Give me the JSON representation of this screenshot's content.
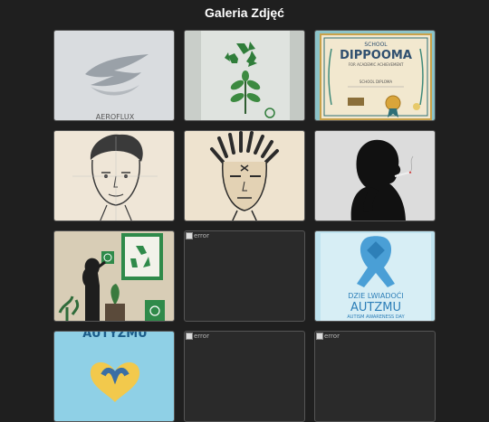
{
  "page": {
    "title": "Galeria Zdjęć"
  },
  "tiles": [
    {
      "kind": "image",
      "name": "aeroflux-logo",
      "caption": "AEROFLUX"
    },
    {
      "kind": "image",
      "name": "recycling-plant"
    },
    {
      "kind": "image",
      "name": "school-diploma",
      "line1": "SCHOOL",
      "line2": "DIPPOOMA",
      "line3": "FOR ACADEMIC ACHIEVEMENT",
      "line4": "SCHOOL DIPLOMA"
    },
    {
      "kind": "image",
      "name": "sketch-man-face"
    },
    {
      "kind": "image",
      "name": "dreadlocks-face"
    },
    {
      "kind": "image",
      "name": "smoker-silhouette"
    },
    {
      "kind": "image",
      "name": "smoker-recycling-room"
    },
    {
      "kind": "broken",
      "name": "broken-image",
      "alt": "error"
    },
    {
      "kind": "image",
      "name": "autism-awareness",
      "line1": "DZIE LWIADOĆI",
      "line2": "AUTZMU",
      "line3": "AUTISM AWARENESS DAY"
    },
    {
      "kind": "image",
      "name": "blue-heart-poster",
      "caption": "AUTYZMU"
    },
    {
      "kind": "broken",
      "name": "broken-image",
      "alt": "error"
    },
    {
      "kind": "broken",
      "name": "broken-image",
      "alt": "error"
    }
  ],
  "colors": {
    "background": "#1f1f1f",
    "tile_border": "#555555"
  }
}
